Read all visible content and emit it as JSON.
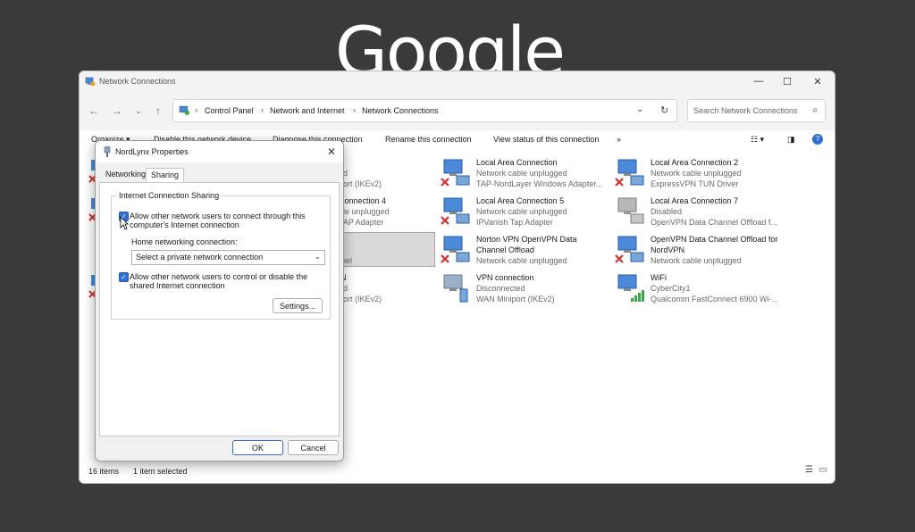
{
  "background": {
    "logo_text": "Google"
  },
  "window": {
    "title": "Network Connections",
    "controls": {
      "minimize": "—",
      "maximize": "☐",
      "close": "✕"
    },
    "address": {
      "crumbs": [
        "Control Panel",
        "Network and Internet",
        "Network Connections"
      ],
      "sep": "›"
    },
    "search": {
      "placeholder": "Search Network Connections"
    },
    "commands": [
      "Organize ▾",
      "Disable this network device",
      "Diagnose this connection",
      "Rename this connection",
      "View status of this connection",
      "»"
    ],
    "status": {
      "count": "16 items",
      "selected": "1 item selected"
    }
  },
  "connections": [
    {
      "name": "",
      "status": "ed",
      "device": "port (IKEv2)"
    },
    {
      "name": "Connection 4",
      "status": "ble unplugged",
      "device": "TAP Adapter"
    },
    {
      "name": "",
      "status": "",
      "device": "unnel"
    },
    {
      "name": "N",
      "status": "ed",
      "device": "port (IKEv2)"
    },
    {
      "name": "Local Area Connection",
      "status": "Network cable unplugged",
      "device": "TAP-NordLayer Windows Adapter..."
    },
    {
      "name": "Local Area Connection 5",
      "status": "Network cable unplugged",
      "device": "IPVanish Tap Adapter"
    },
    {
      "name": "Norton VPN OpenVPN Data",
      "name2": "Channel Offload",
      "status": "Network cable unplugged"
    },
    {
      "name": "VPN connection",
      "status": "Disconnected",
      "device": "WAN Miniport (IKEv2)"
    },
    {
      "name": "Local Area Connection 2",
      "status": "Network cable unplugged",
      "device": "ExpressVPN TUN Driver"
    },
    {
      "name": "Local Area Connection 7",
      "status": "Disabled",
      "device": "OpenVPN Data Channel Offload f..."
    },
    {
      "name": "OpenVPN Data Channel Offload for",
      "name2": "NordVPN",
      "status": "Network cable unplugged"
    },
    {
      "name": "WiFi",
      "status": "CyberCity1",
      "device": "Qualcomm FastConnect 6900 Wi-..."
    }
  ],
  "dialog": {
    "title": "NordLynx Properties",
    "close": "✕",
    "tabs": [
      "Networking",
      "Sharing"
    ],
    "group_label": "Internet Connection Sharing",
    "allow_connect_1": "Allow other network users to connect through this",
    "allow_connect_2": "computer's Internet connection",
    "home_label": "Home networking connection:",
    "select_value": "Select a private network connection",
    "allow_control_1": "Allow other network users to control or disable the",
    "allow_control_2": "shared Internet connection",
    "settings": "Settings...",
    "ok": "OK",
    "cancel": "Cancel",
    "check_mark": "✓"
  },
  "colors": {
    "accent": "#2f6fd3",
    "error_x": "#d32f2f"
  }
}
